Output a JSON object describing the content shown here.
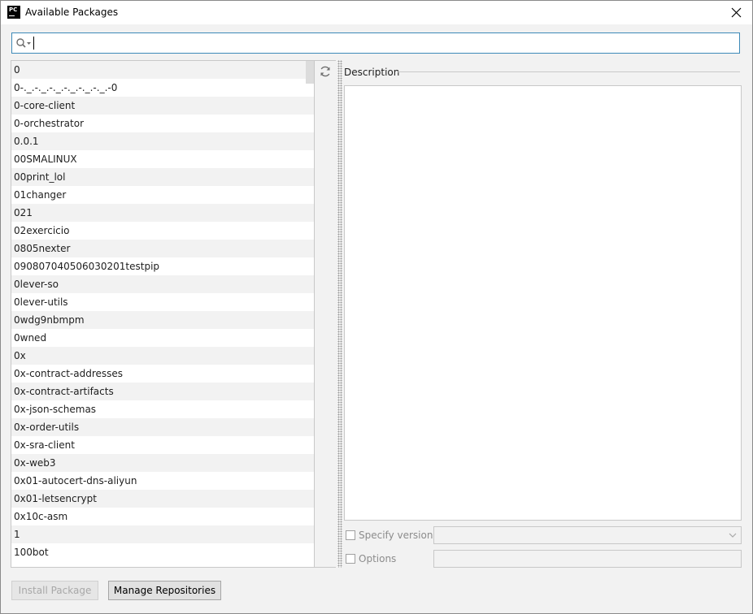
{
  "window": {
    "title": "Available Packages"
  },
  "search": {
    "value": "",
    "placeholder": ""
  },
  "packages": [
    "0",
    "0-._.-._.-._.-._.-._.-._.-0",
    "0-core-client",
    "0-orchestrator",
    "0.0.1",
    "00SMALINUX",
    "00print_lol",
    "01changer",
    "021",
    "02exercicio",
    "0805nexter",
    "090807040506030201testpip",
    "0lever-so",
    "0lever-utils",
    "0wdg9nbmpm",
    "0wned",
    "0x",
    "0x-contract-addresses",
    "0x-contract-artifacts",
    "0x-json-schemas",
    "0x-order-utils",
    "0x-sra-client",
    "0x-web3",
    "0x01-autocert-dns-aliyun",
    "0x01-letsencrypt",
    "0x10c-asm",
    "1",
    "100bot"
  ],
  "description": {
    "label": "Description",
    "text": ""
  },
  "options": {
    "specify_version_label": "Specify version",
    "specify_version_checked": false,
    "version_value": "",
    "options_label": "Options",
    "options_checked": false,
    "options_value": ""
  },
  "buttons": {
    "install": "Install Package",
    "manage": "Manage Repositories"
  },
  "icons": {
    "refresh": "refresh-icon",
    "search": "search-icon",
    "close": "close-icon",
    "app": "pycharm-icon"
  },
  "colors": {
    "search_border": "#3d8ab8",
    "alt_row": "#f2f2f2",
    "background": "#f2f2f2"
  }
}
